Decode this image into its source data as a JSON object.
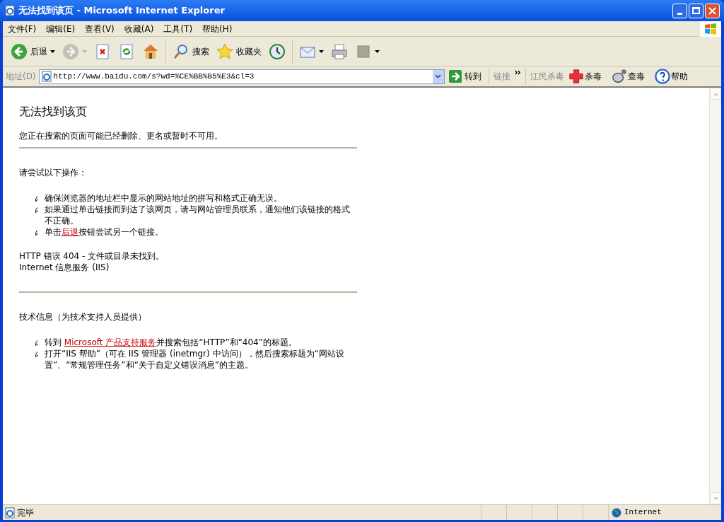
{
  "window": {
    "title": "无法找到该页 - Microsoft Internet Explorer"
  },
  "menu": [
    "文件(F)",
    "编辑(E)",
    "查看(V)",
    "收藏(A)",
    "工具(T)",
    "帮助(H)"
  ],
  "toolbar": [
    {
      "kind": "labeled",
      "label": "后退",
      "dropdown": true,
      "disabled": false
    },
    {
      "kind": "icon",
      "dropdown": true,
      "disabled": true
    },
    {
      "kind": "icon",
      "dropdown": false,
      "disabled": false
    },
    {
      "kind": "icon",
      "dropdown": false,
      "disabled": false
    },
    {
      "kind": "icon",
      "dropdown": false,
      "disabled": false
    },
    {
      "kind": "labeled",
      "label": "搜索",
      "dropdown": false,
      "disabled": false
    },
    {
      "kind": "labeled",
      "label": "收藏夹",
      "dropdown": false,
      "disabled": false
    },
    {
      "kind": "icon",
      "dropdown": false,
      "disabled": false
    },
    {
      "kind": "icon",
      "dropdown": true,
      "disabled": false
    },
    {
      "kind": "icon",
      "dropdown": false,
      "disabled": false
    },
    {
      "kind": "icon",
      "dropdown": true,
      "disabled": false
    }
  ],
  "address": {
    "label": "地址(D)",
    "value": "http://www.baidu.com/s?wd=%CE%BB%B5%E3&cl=3",
    "go": "转到"
  },
  "links": {
    "label": "链接"
  },
  "plugin": {
    "label": "江民杀毒",
    "buttons": [
      {
        "label": "杀毒"
      },
      {
        "label": "查毒"
      },
      {
        "label": "帮助"
      }
    ]
  },
  "page": {
    "heading": "无法找到该页",
    "intro": "您正在搜索的页面可能已经删除、更名或暂时不可用。",
    "try_heading": "请尝试以下操作：",
    "try_items": [
      {
        "text": "确保浏览器的地址栏中显示的网站地址的拼写和格式正确无误。"
      },
      {
        "text": "如果通过单击链接而到达了该网页，请与网站管理员联系，通知他们该链接的格式不正确。"
      },
      {
        "text": "单击",
        "link": "后退",
        "after": "按钮尝试另一个链接。"
      }
    ],
    "error_line": "HTTP 错误 404 - 文件或目录未找到。",
    "server_line": "Internet 信息服务 (IIS)",
    "tech_heading": "技术信息（为技术支持人员提供）",
    "tech_items": [
      {
        "text": "转到 ",
        "link": "Microsoft 产品支持服务",
        "after": "并搜索包括“HTTP”和“404”的标题。"
      },
      {
        "text": "打开“IIS 帮助”（可在 IIS 管理器 (inetmgr) 中访问），然后搜索标题为“网站设置”、“常规管理任务”和“关于自定义错误消息”的主题。"
      }
    ]
  },
  "status": {
    "text": "完毕",
    "zone": "Internet"
  }
}
